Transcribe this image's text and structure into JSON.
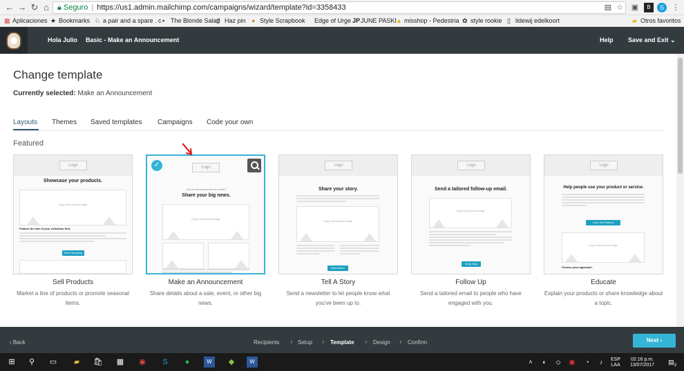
{
  "browser": {
    "secure_label": "Seguro",
    "url": "https://us1.admin.mailchimp.com/campaigns/wizard/template?id=3358433"
  },
  "bookmarks": [
    "Aplicaciones",
    "Bookmarks",
    "a pair and a spare . c",
    "The Blonde Salad",
    "Haz pin",
    "Style Scrapbook",
    "Edge of Urge",
    "JUNE PASKI",
    "misshop - Pedestria",
    "style rookie",
    "lidewij edelkoort",
    "Otros favoritos"
  ],
  "header": {
    "greeting": "Hola Julio",
    "campaign": "Basic - Make an Announcement",
    "help": "Help",
    "save_exit": "Save and Exit"
  },
  "page": {
    "title": "Change template",
    "current_label": "Currently selected:",
    "current_value": "Make an Announcement",
    "section": "Featured"
  },
  "tabs": [
    "Layouts",
    "Themes",
    "Saved templates",
    "Campaigns",
    "Code your own"
  ],
  "cards": [
    {
      "name": "Sell Products",
      "desc": "Market a line of products or promote seasonal items.",
      "preview": {
        "logo": "Logo",
        "headline": "Showcase your products.",
        "feature": "Feature the star of your collection first.",
        "button": "Start Shopping",
        "image": "Drag a feed\nproduct image"
      }
    },
    {
      "name": "Make an Announcement",
      "desc": "Share details about a sale, event, or other big news.",
      "preview": {
        "logo": "Logo",
        "kicker": "Got an announcement to make?",
        "headline": "Share your big news.",
        "image": "Drag a feed\nproduct image"
      }
    },
    {
      "name": "Tell A Story",
      "desc": "Send a newsletter to let people know what you've been up to.",
      "preview": {
        "logo": "Logo",
        "headline": "Share your story.",
        "button": "Read More",
        "image": "Drag a feed\nproduct image"
      }
    },
    {
      "name": "Follow Up",
      "desc": "Send a tailored email to people who have engaged with you.",
      "preview": {
        "logo": "Logo",
        "headline": "Send a tailored follow-up email.",
        "button": "Shop Now",
        "image": "Drag a feed\nproduct image"
      }
    },
    {
      "name": "Educate",
      "desc": "Explain your products or share knowledge about a topic.",
      "preview": {
        "logo": "Logo",
        "headline": "Help people use your product or service.",
        "button": "Let's Get Started",
        "subhead": "Choose your approach.",
        "image": "Drag a feed\nproduct image"
      }
    }
  ],
  "footer": {
    "back": "Back",
    "steps": [
      "Recipients",
      "Setup",
      "Template",
      "Design",
      "Confirm"
    ],
    "active_step": "Template",
    "next": "Next"
  },
  "taskbar": {
    "lang": "ESP",
    "layout": "LAA",
    "time": "02:16 p.m.",
    "date": "13/07/2017",
    "notifications": "3"
  },
  "colors": {
    "accent": "#34b5d6",
    "header_bg": "#333b3f",
    "active_tab": "#2c5a6e",
    "button_blue": "#1ea0c2"
  }
}
